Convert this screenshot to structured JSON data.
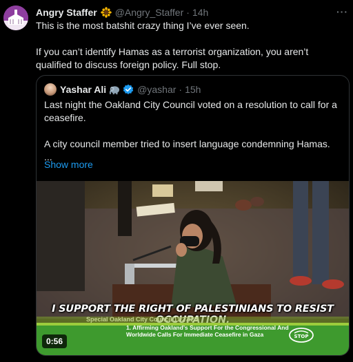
{
  "tweet": {
    "author_name": "Angry Staffer",
    "author_handle": "@Angry_Staffer",
    "separator": "·",
    "time": "14h",
    "more_label": "···",
    "paragraphs": [
      "This is the most batshit crazy thing I’ve ever seen.",
      "If you can’t identify Hamas as a terrorist organization, you aren’t qualified to discuss foreign policy. Full stop."
    ],
    "name_emoji_icon": "sunflower-icon"
  },
  "quoted_tweet": {
    "author_name": "Yashar Ali",
    "author_handle": "@yashar",
    "separator": "·",
    "time": "15h",
    "paragraphs": [
      "Last night the Oakland City Council voted on a resolution to call for a ceasefire.",
      "A city council member tried to insert language condemning Hamas."
    ],
    "ellipsis": "...",
    "show_more_label": "Show more",
    "badges": [
      "elephant-icon",
      "verified-badge-icon"
    ],
    "video": {
      "caption": "I SUPPORT THE RIGHT OF PALESTINIANS TO RESIST OCCUPATION,",
      "lower_third_title": "Special Oakland City Council 11/27/23",
      "agenda_item": "1. Affirming Oakland’s Support For the Congressional And Worldwide Calls For Immediate Ceasefire in Gaza",
      "logo_text": "STOP",
      "duration": "0:56"
    }
  },
  "colors": {
    "background": "#000000",
    "text": "#e7e9ea",
    "secondary": "#71767b",
    "link": "#1d9bf0",
    "border": "#2f3336",
    "verified": "#1d9bf0"
  }
}
